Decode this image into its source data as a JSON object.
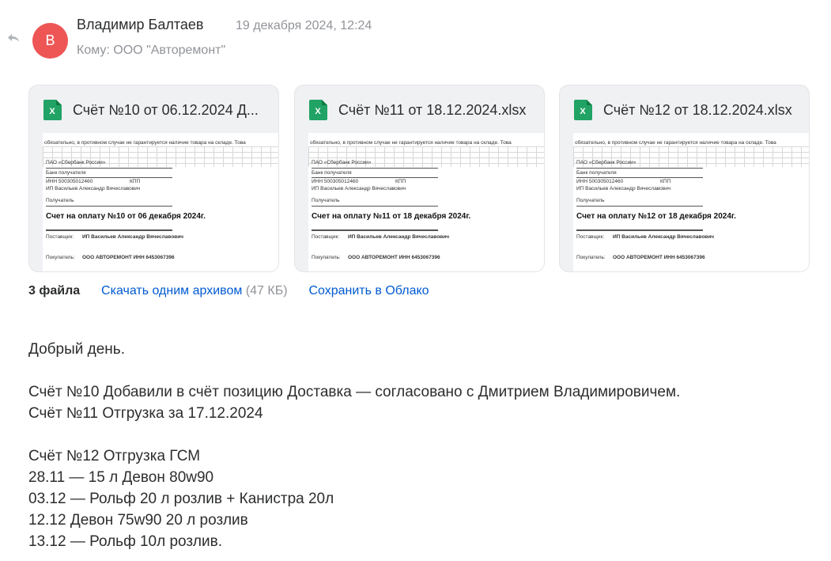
{
  "message": {
    "avatar_letter": "В",
    "sender": "Владимир Балтаев",
    "date": "19 декабря 2024, 12:24",
    "to": "Кому: ООО \"Авторемонт\""
  },
  "attachments": [
    {
      "name": "Счёт №10 от 06.12.2024 Д...",
      "preview": {
        "notice": "обязательно, в противном случае не гарантируется наличие товара на складе. Това",
        "bank": "ПАО «Сбербанк России»",
        "bank_label": "Банк получателя",
        "inn": "ИНН   500305012460",
        "kpp": "КПП",
        "recipient_name": "ИП Васильев Александр Вячеславович",
        "recipient_label": "Получатель",
        "title": "Счет на оплату №10 от 06 декабря 2024г.",
        "supplier_label": "Поставщик:",
        "supplier": "ИП Васильев Александр Вячеславович",
        "buyer_label": "Покупатель:",
        "buyer": "ООО АВТОРЕМОНТ ИНН  6453067396"
      }
    },
    {
      "name": "Счёт №11 от 18.12.2024.xlsx",
      "preview": {
        "notice": "обязательно, в противном случае не гарантируется наличие товара на складе. Това",
        "bank": "ПАО «Сбербанк России»",
        "bank_label": "Банк получателя",
        "inn": "ИНН   500305012460",
        "kpp": "КПП",
        "recipient_name": "ИП Васильев Александр Вячеславович",
        "recipient_label": "Получатель",
        "title": "Счет на оплату №11 от 18 декабря 2024г.",
        "supplier_label": "Поставщик:",
        "supplier": "ИП Васильев Александр Вячеславович",
        "buyer_label": "Покупатель:",
        "buyer": "ООО АВТОРЕМОНТ ИНН  6453067396"
      }
    },
    {
      "name": "Счёт №12 от 18.12.2024.xlsx",
      "preview": {
        "notice": "обязательно, в противном случае не гарантируется наличие товара на складе. Това",
        "bank": "ПАО «Сбербанк России»",
        "bank_label": "Банк получателя",
        "inn": "ИНН   500305012460",
        "kpp": "КПП",
        "recipient_name": "ИП Васильев Александр Вячеславович",
        "recipient_label": "Получатель",
        "title": "Счет на оплату №12 от 18 декабря 2024г.",
        "supplier_label": "Поставщик:",
        "supplier": "ИП Васильев Александр Вячеславович",
        "buyer_label": "Покупатель:",
        "buyer": "ООО АВТОРЕМОНТ ИНН  6453067396"
      }
    }
  ],
  "files_bar": {
    "count": "3 файла",
    "download_all": "Скачать одним архивом",
    "size": "(47 КБ)",
    "save_cloud": "Сохранить в Облако"
  },
  "body_lines": [
    "Добрый день.",
    "",
    "Счёт №10 Добавили в счёт позицию Доставка — согласовано с Дмитрием Владимировичем.",
    "Счёт №11 Отгрузка за 17.12.2024",
    "",
    "Счёт №12 Отгрузка ГСМ",
    "28.11 — 15 л Девон 80w90",
    "03.12 — Рольф 20 л розлив + Канистра 20л",
    "12.12 Девон 75w90 20 л розлив",
    "13.12 — Рольф 10л розлив."
  ],
  "colors": {
    "avatar_bg": "#ee5656",
    "link": "#005bd1",
    "excel_green": "#21a366"
  }
}
